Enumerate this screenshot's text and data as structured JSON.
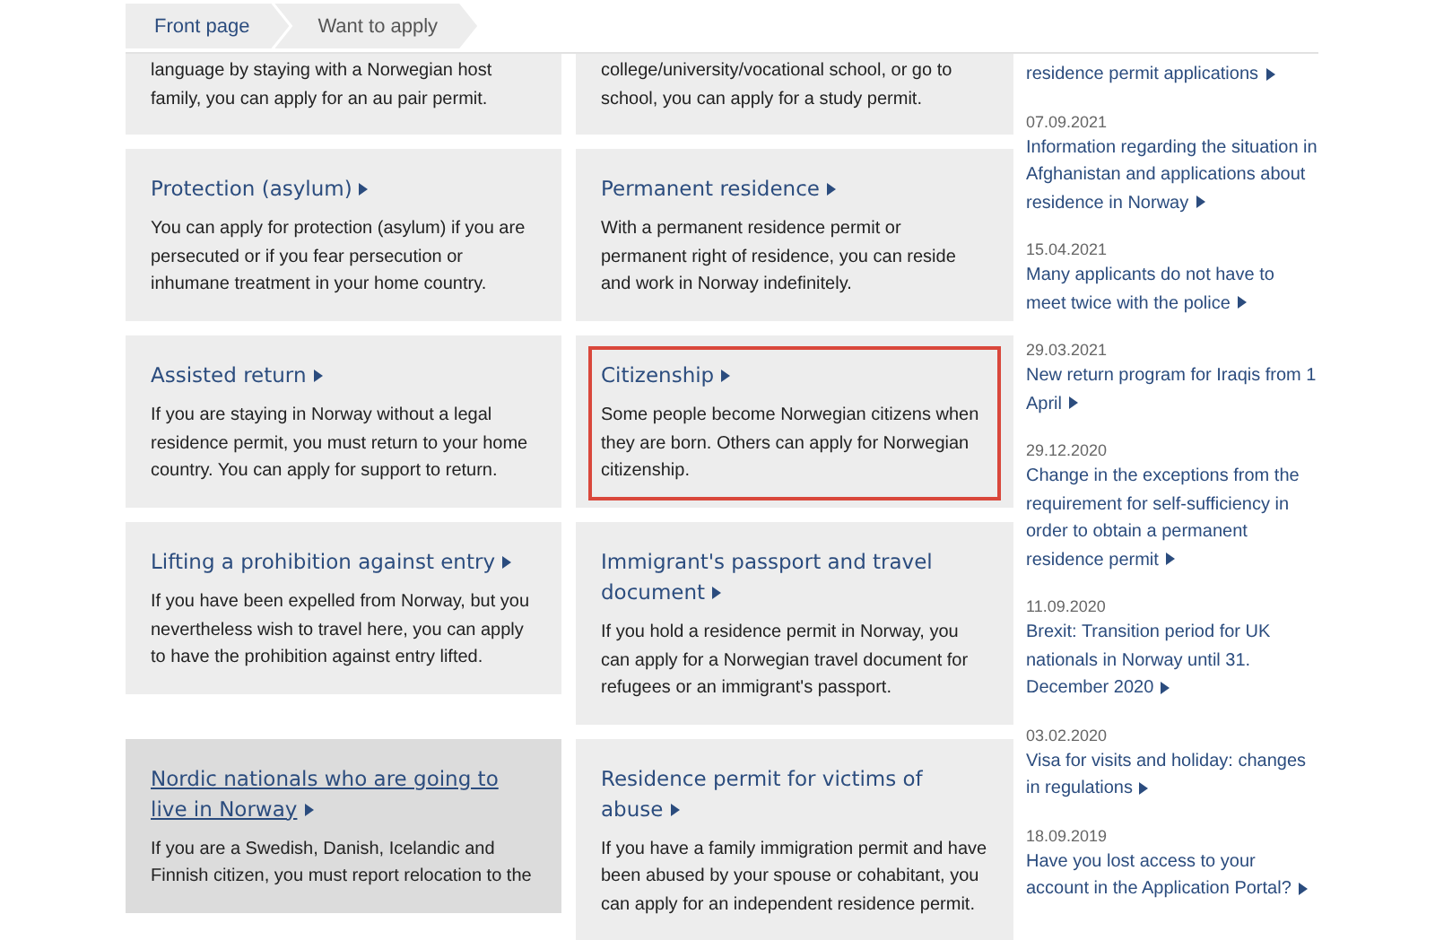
{
  "breadcrumb": [
    {
      "label": "Front page",
      "selected": false
    },
    {
      "label": "Want to apply",
      "selected": true
    }
  ],
  "cards": [
    {
      "text": "language by staying with a Norwegian host family, you can apply for an au pair permit.",
      "highlighted": false,
      "outlined": false
    },
    {
      "text": "college/university/vocational school, or go to school, you can apply for a study permit.",
      "highlighted": false,
      "outlined": false
    },
    {
      "title": "Protection (asylum)",
      "text": "You can apply for protection (asylum) if you are persecuted or if you fear persecution or inhumane treatment in your home country.",
      "highlighted": false,
      "outlined": false
    },
    {
      "title": "Permanent residence",
      "text": "With a permanent residence permit or permanent right of residence, you can reside and work in Norway indefinitely.",
      "highlighted": false,
      "outlined": false
    },
    {
      "title": "Assisted return",
      "text": "If you are staying in Norway without a legal residence permit, you must return to your home country. You can apply for support to return.",
      "highlighted": false,
      "outlined": false
    },
    {
      "title": "Citizenship",
      "text": "Some people become Norwegian citizens when they are born. Others can apply for Norwegian citizenship.",
      "highlighted": false,
      "outlined": true
    },
    {
      "title": "Lifting a prohibition against entry",
      "text": "If you have been expelled from Norway, but you nevertheless wish to travel here, you can apply to have the prohibition against entry lifted.",
      "highlighted": false,
      "outlined": false
    },
    {
      "title": "Immigrant's passport and travel document",
      "text": "If you hold a residence permit in Norway, you can apply for a Norwegian travel document for refugees or an immigrant's passport.",
      "highlighted": false,
      "outlined": false
    },
    {
      "title": "Nordic nationals who are going to live in Norway",
      "text": "If you are a Swedish, Danish, Icelandic and Finnish citizen, you must report relocation to the",
      "highlighted": true,
      "outlined": false
    },
    {
      "title": "Residence permit for victims of abuse",
      "text": "If you have a family immigration permit and have been abused by your spouse or cohabitant, you can apply for an independent residence permit.",
      "highlighted": false,
      "outlined": false
    }
  ],
  "news": [
    {
      "title": "residence permit applications"
    },
    {
      "date": "07.09.2021",
      "title": "Information regarding the situation in Afghanistan and applications about residence in Norway"
    },
    {
      "date": "15.04.2021",
      "title": "Many applicants do not have to meet twice with the police"
    },
    {
      "date": "29.03.2021",
      "title": "New return program for Iraqis from 1 April"
    },
    {
      "date": "29.12.2020",
      "title": "Change in the exceptions from the requirement for self-sufficiency in order to obtain a permanent residence permit"
    },
    {
      "date": "11.09.2020",
      "title": "Brexit: Transition period for UK nationals in Norway until 31. December 2020"
    },
    {
      "date": "03.02.2020",
      "title": "Visa for visits and holiday: changes in regulations"
    },
    {
      "date": "18.09.2019",
      "title": "Have you lost access to your account in the Application Portal?"
    }
  ]
}
